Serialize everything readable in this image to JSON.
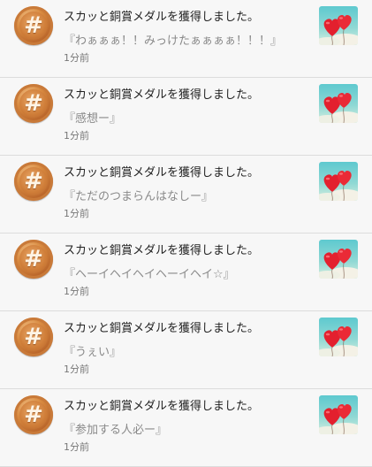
{
  "notifications": [
    {
      "title": "スカッと銅賞メダルを獲得しました。",
      "quote": "『わぁぁぁ！！みっけたぁぁぁぁ！！！』",
      "time": "1分前"
    },
    {
      "title": "スカッと銅賞メダルを獲得しました。",
      "quote": "『感想ー』",
      "time": "1分前"
    },
    {
      "title": "スカッと銅賞メダルを獲得しました。",
      "quote": "『ただのつまらんはなしー』",
      "time": "1分前"
    },
    {
      "title": "スカッと銅賞メダルを獲得しました。",
      "quote": "『ヘーイヘイヘイヘーイヘイ☆』",
      "time": "1分前"
    },
    {
      "title": "スカッと銅賞メダルを獲得しました。",
      "quote": "『うぇい』",
      "time": "1分前"
    },
    {
      "title": "スカッと銅賞メダルを獲得しました。",
      "quote": "『参加する人必ー』",
      "time": "1分前"
    }
  ],
  "icons": {
    "medal": "bronze-medal-icon",
    "thumbnail": "heart-balloons-thumbnail"
  },
  "colors": {
    "background": "#f7f7f7",
    "divider": "#dcdcdc",
    "title_text": "#222222",
    "quote_text": "#8a8a8a",
    "time_text": "#777777",
    "medal_bronze": "#c97a39",
    "balloon_red": "#e3202e"
  }
}
